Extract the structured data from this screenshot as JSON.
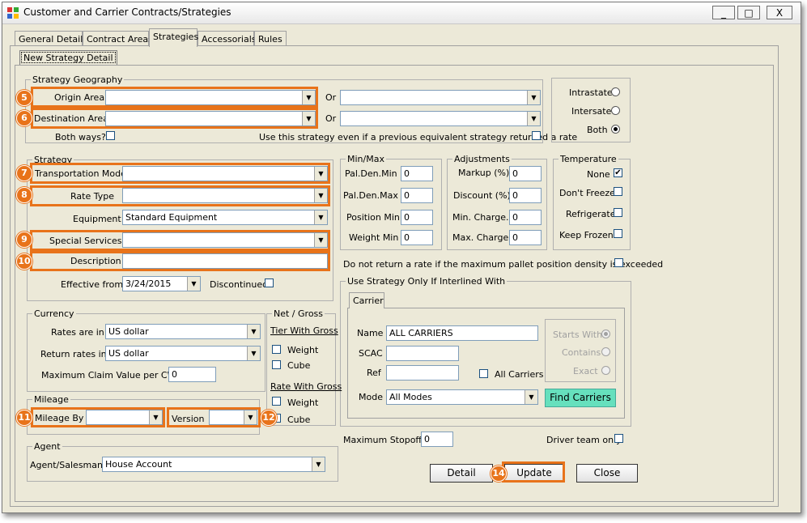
{
  "window": {
    "title": "Customer and Carrier Contracts/Strategies",
    "minimize": "_",
    "maximize": "□",
    "close": "X"
  },
  "tabs": [
    "General Details",
    "Contract Areas",
    "Strategies",
    "Accessorials",
    "Rules"
  ],
  "subtab": "New Strategy Detail",
  "geography": {
    "legend": "Strategy Geography",
    "origin_label": "Origin Area",
    "origin_value": "",
    "or1": "Or",
    "origin_or_value": "",
    "dest_label": "Destination Area",
    "dest_value": "",
    "or2": "Or",
    "dest_or_value": "",
    "both_ways": "Both ways?",
    "use_strategy": "Use this strategy even if a previous equivalent strategy returned a rate"
  },
  "state_radios": {
    "intrastate": "Intrastate",
    "intersate": "Intersate",
    "both": "Both"
  },
  "strategy": {
    "legend": "Strategy",
    "transport_mode": "Transportation Mode",
    "transport_value": "",
    "rate_type": "Rate Type",
    "rate_value": "",
    "equipment": "Equipment",
    "equipment_value": "Standard Equipment",
    "special_services": "Special Services",
    "special_value": "",
    "description": "Description",
    "description_value": "",
    "effective_from": "Effective from",
    "effective_value": "3/24/2015",
    "discontinued": "Discontinued"
  },
  "minmax": {
    "legend": "Min/Max",
    "pal_den_min": "Pal.Den.Min",
    "pal_den_max": "Pal.Den.Max",
    "position_min": "Position Min",
    "weight_min": "Weight Min",
    "v1": "0",
    "v2": "0",
    "v3": "0",
    "v4": "0"
  },
  "adjustments": {
    "legend": "Adjustments",
    "markup": "Markup (%)",
    "discount": "Discount (%)",
    "min_charge": "Min. Charge.",
    "max_charge": "Max. Charge",
    "v1": "0",
    "v2": "0",
    "v3": "0",
    "v4": "0"
  },
  "temperature": {
    "legend": "Temperature",
    "none": "None",
    "dont_freeze": "Don't Freeze",
    "refrigerate": "Refrigerate",
    "keep_frozen": "Keep Frozen"
  },
  "pallet_note": "Do not return a rate if the maximum pallet position density is exceeded",
  "currency": {
    "legend": "Currency",
    "rates_in": "Rates are in",
    "rates_value": "US dollar",
    "return_rates": "Return rates in",
    "return_value": "US dollar",
    "max_claim": "Maximum Claim Value per CWT",
    "max_claim_value": "0"
  },
  "netgross": {
    "legend": "Net / Gross",
    "tier": "Tier With Gross",
    "weight": "Weight",
    "cube": "Cube",
    "rate": "Rate With Gross",
    "weight2": "Weight",
    "cube2": "Cube"
  },
  "mileage": {
    "legend": "Mileage",
    "mileage_by": "Mileage By",
    "version": "Version"
  },
  "agent": {
    "legend": "Agent",
    "label": "Agent/Salesman",
    "value": "House Account"
  },
  "interline": {
    "legend": "Use Strategy Only If Interlined With",
    "tab": "Carrier",
    "name": "Name",
    "name_value": "ALL CARRIERS",
    "scac": "SCAC",
    "ref": "Ref",
    "all_carriers": "All Carriers",
    "mode": "Mode",
    "mode_value": "All Modes",
    "starts_with": "Starts With",
    "contains": "Contains",
    "exact": "Exact",
    "find": "Find Carriers"
  },
  "max_stopoffs": "Maximum Stopoffs",
  "max_stopoffs_value": "0",
  "driver_team": "Driver team only",
  "buttons": {
    "detail": "Detail",
    "update": "Update",
    "close": "Close"
  },
  "badges": [
    "5",
    "6",
    "7",
    "8",
    "9",
    "10",
    "11",
    "12",
    "14"
  ],
  "colors": {
    "highlight": "#e8731a",
    "find_button": "#66e0bd"
  }
}
